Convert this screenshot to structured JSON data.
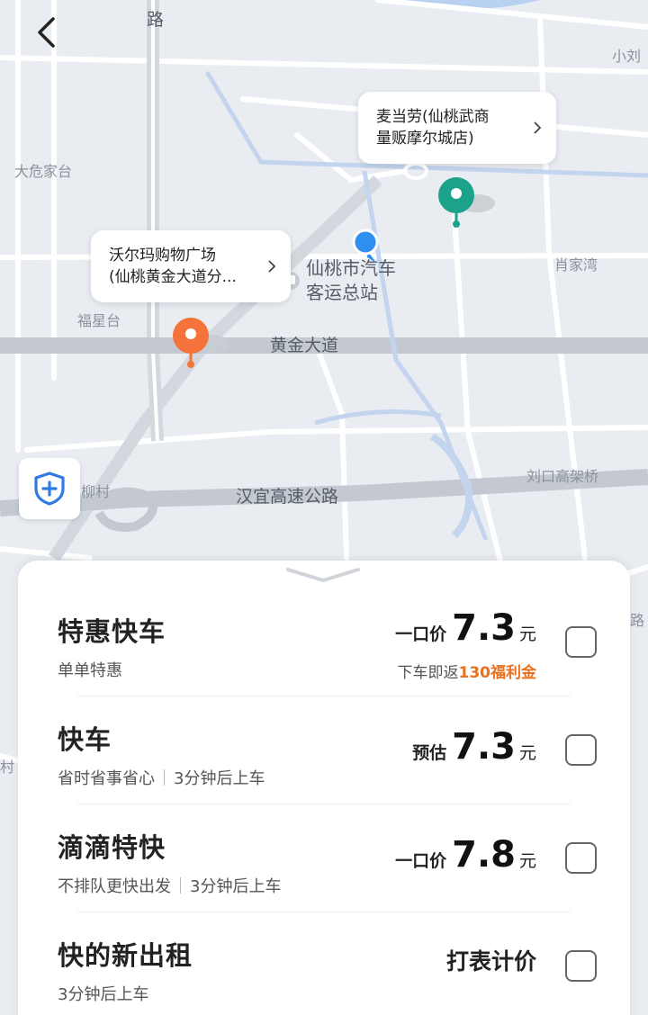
{
  "map": {
    "labels": {
      "top_road": "路",
      "xiao_liu": "小刘",
      "da_wei_jia_tai": "大危家台",
      "xiao_jia_wan": "肖家湾",
      "fu_xing_tai": "福星台",
      "huang_jin_da_dao": "黄金大道",
      "liu_cun": "柳村",
      "han_yi_gao_su": "汉宜高速公路",
      "liu_kou_gao_jia_qiao": "刘口高架桥",
      "edge_right": "路",
      "edge_left": "村",
      "bus_station_line1": "仙桃市汽车",
      "bus_station_line2": "客运总站"
    },
    "callouts": {
      "mcdonalds": {
        "line1": "麦当劳(仙桃武商",
        "line2": "量贩摩尔城店)"
      },
      "walmart": {
        "line1": "沃尔玛购物广场",
        "line2": "(仙桃黄金大道分..."
      }
    },
    "colors": {
      "pin_green": "#1aa38a",
      "pin_orange": "#f5733a",
      "pin_blue": "#2f8ff0",
      "accent_orange": "#e8701f"
    }
  },
  "rides": [
    {
      "name": "特惠快车",
      "subtitle": [
        "单单特惠"
      ],
      "price_prefix": "一口价",
      "price": "7.3",
      "unit": "元",
      "promo_text": "下车即返",
      "promo_highlight": "130福利金"
    },
    {
      "name": "快车",
      "subtitle": [
        "省时省事省心",
        "3分钟后上车"
      ],
      "price_prefix": "预估",
      "price": "7.3",
      "unit": "元"
    },
    {
      "name": "滴滴特快",
      "subtitle": [
        "不排队更快出发",
        "3分钟后上车"
      ],
      "price_prefix": "一口价",
      "price": "7.8",
      "unit": "元"
    },
    {
      "name": "快的新出租",
      "subtitle": [
        "3分钟后上车"
      ],
      "meter_text": "打表计价"
    }
  ],
  "icons": {
    "back": "chevron-left-icon",
    "shield": "shield-plus-icon",
    "handle": "chevron-down-icon",
    "callout_chevron": "chevron-right-icon",
    "bus": "bus-station-icon"
  }
}
